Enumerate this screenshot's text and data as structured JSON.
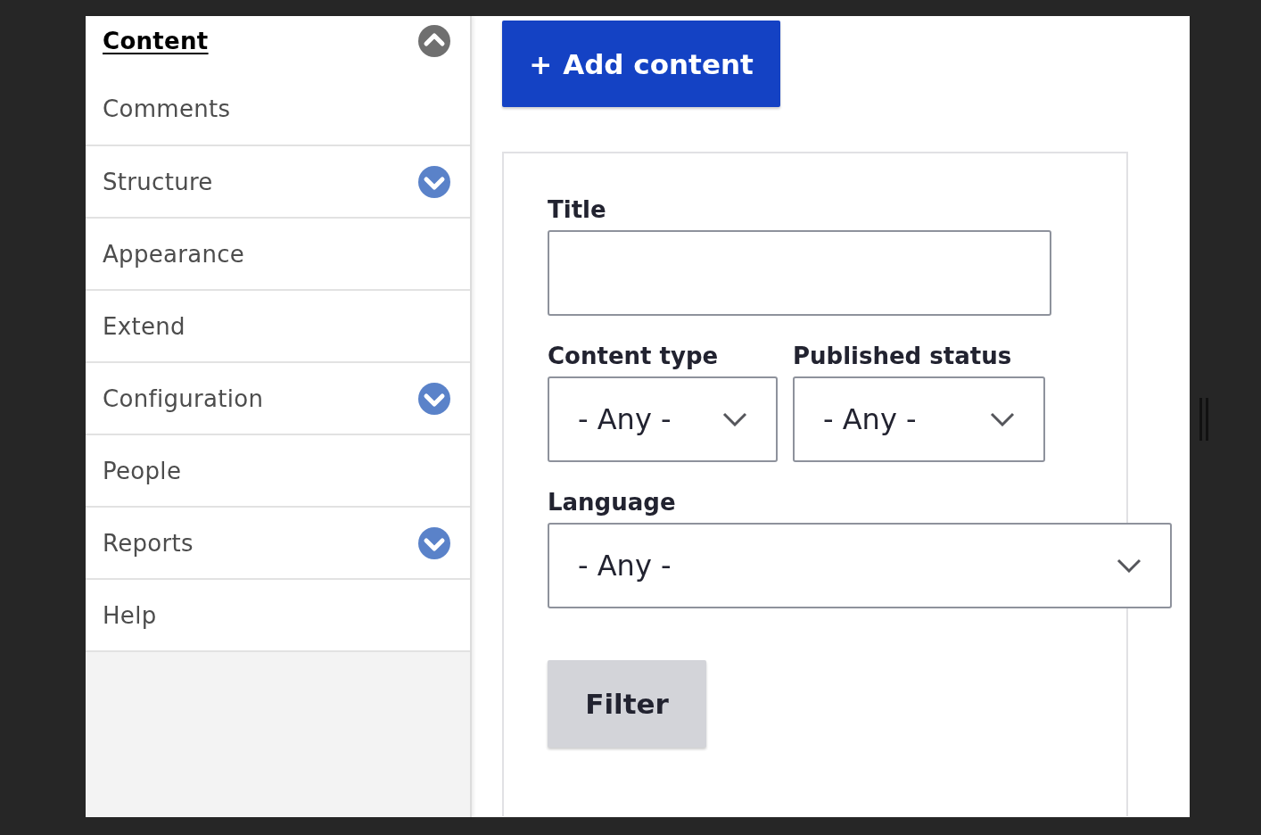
{
  "sidebar": {
    "items": [
      {
        "label": "Content",
        "selected": true,
        "expanded": true,
        "children": [
          {
            "label": "Comments",
            "selected": false
          }
        ]
      },
      {
        "label": "Structure",
        "selected": false,
        "expanded": false
      },
      {
        "label": "Appearance",
        "selected": false
      },
      {
        "label": "Extend",
        "selected": false
      },
      {
        "label": "Configuration",
        "selected": false,
        "expanded": false
      },
      {
        "label": "People",
        "selected": false
      },
      {
        "label": "Reports",
        "selected": false,
        "expanded": false
      },
      {
        "label": "Help",
        "selected": false
      }
    ]
  },
  "add_button": {
    "icon": "+",
    "label": "Add content"
  },
  "filters": {
    "fields": [
      {
        "kind": "text",
        "label": "Title"
      },
      {
        "kind": "select",
        "label": "Content type",
        "value": "- Any -"
      },
      {
        "kind": "select",
        "label": "Published status",
        "value": "- Any -"
      },
      {
        "kind": "select",
        "label": "Language",
        "value": "- Any -"
      }
    ],
    "submit": "Filter"
  }
}
